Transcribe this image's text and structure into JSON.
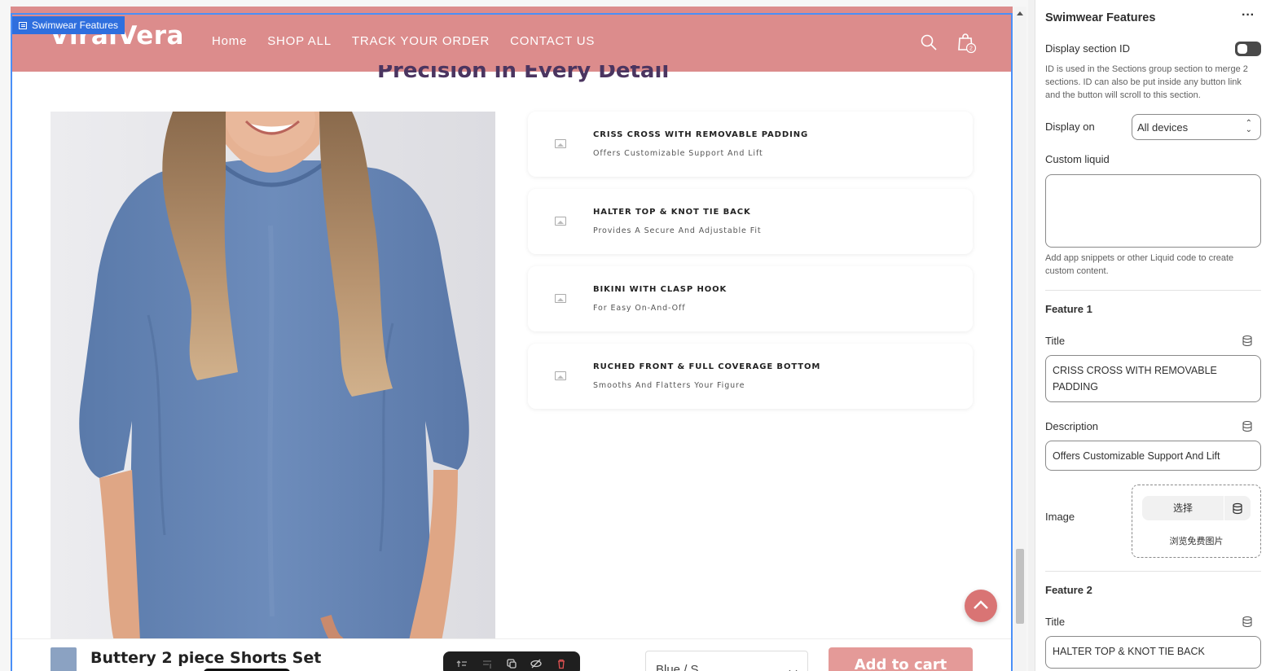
{
  "store": {
    "logo": "ViralVera",
    "nav": [
      "Home",
      "SHOP ALL",
      "TRACK YOUR ORDER",
      "CONTACT US"
    ],
    "cart_count": "2",
    "section_heading": "Precision in Every Detail"
  },
  "section_tag": "Swimwear Features",
  "features": [
    {
      "title": "CRISS CROSS WITH REMOVABLE PADDING",
      "desc": "Offers Customizable Support And Lift"
    },
    {
      "title": "HALTER TOP & KNOT TIE BACK",
      "desc": "Provides A Secure And Adjustable Fit"
    },
    {
      "title": "BIKINI WITH CLASP HOOK",
      "desc": "For Easy On-And-Off"
    },
    {
      "title": "RUCHED FRONT & FULL COVERAGE BOTTOM",
      "desc": "Smooths And Flatters Your Figure"
    }
  ],
  "sticky": {
    "product_title": "Buttery 2 piece Shorts Set",
    "variant": "Blue / S",
    "add_to_cart": "Add to cart"
  },
  "settings": {
    "title": "Swimwear Features",
    "display_section_id": "Display section ID",
    "display_section_id_help": "ID is used in the Sections group section to merge 2 sections. ID can also be put inside any button link and the button will scroll to this section.",
    "display_on_label": "Display on",
    "display_on_value": "All devices",
    "custom_liquid_label": "Custom liquid",
    "custom_liquid_help": "Add app snippets or other Liquid code to create custom content.",
    "feature1": {
      "heading": "Feature 1",
      "title_label": "Title",
      "title_value": "CRISS CROSS WITH REMOVABLE PADDING",
      "desc_label": "Description",
      "desc_value": "Offers Customizable Support And Lift",
      "image_label": "Image",
      "choose": "选择",
      "browse": "浏览免费图片"
    },
    "feature2": {
      "heading": "Feature 2",
      "title_label": "Title",
      "title_value": "HALTER TOP & KNOT TIE BACK"
    }
  },
  "colors": {
    "header_bg": "#dc8c8c",
    "accent": "#e49a98",
    "selection": "#4a8ff7"
  }
}
